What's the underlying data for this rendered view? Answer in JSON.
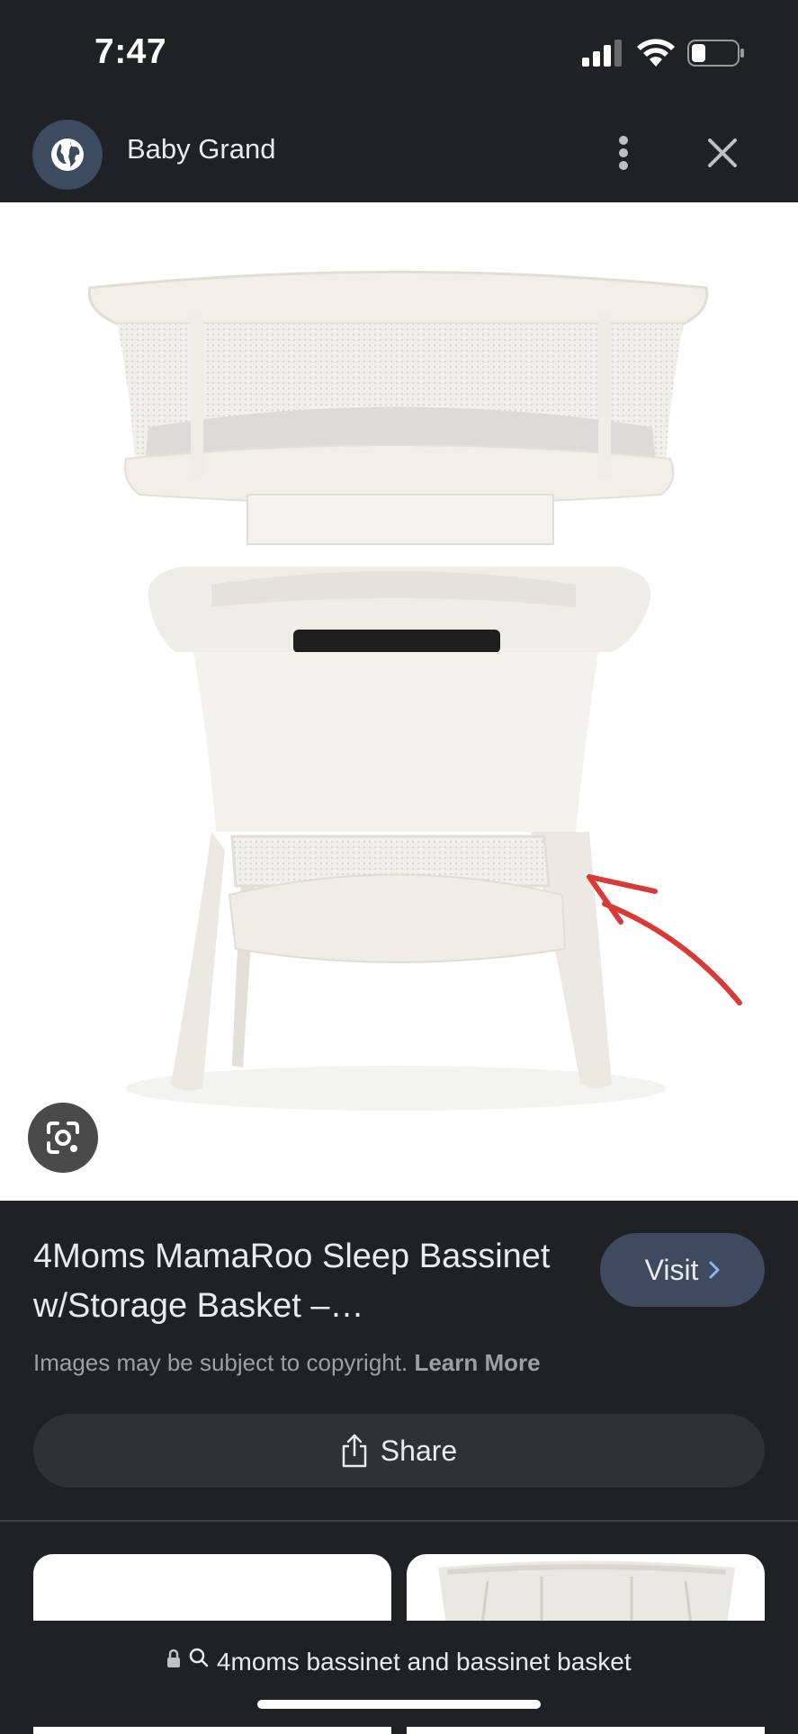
{
  "status_bar": {
    "time": "7:47",
    "signal_icon": "signal-icon",
    "wifi_icon": "wifi-icon",
    "battery_icon": "battery-icon",
    "battery_level": 0.3
  },
  "header": {
    "site_name": "Baby Grand",
    "site_icon": "globe-icon",
    "more_icon": "more-vert-icon",
    "close_icon": "close-icon"
  },
  "image": {
    "lens_icon": "google-lens-icon"
  },
  "result": {
    "title": "4Moms MamaRoo Sleep Bassinet w/Storage Basket –…",
    "visit_label": "Visit",
    "copyright_text": "Images may be subject to copyright.",
    "learn_more": "Learn More",
    "share_label": "Share"
  },
  "url_bar": {
    "query": "4moms bassinet and bassinet basket"
  },
  "colors": {
    "background": "#202124",
    "button": "#3e4a5e",
    "share_button": "#303134",
    "annotation_arrow": "#d93a36"
  }
}
